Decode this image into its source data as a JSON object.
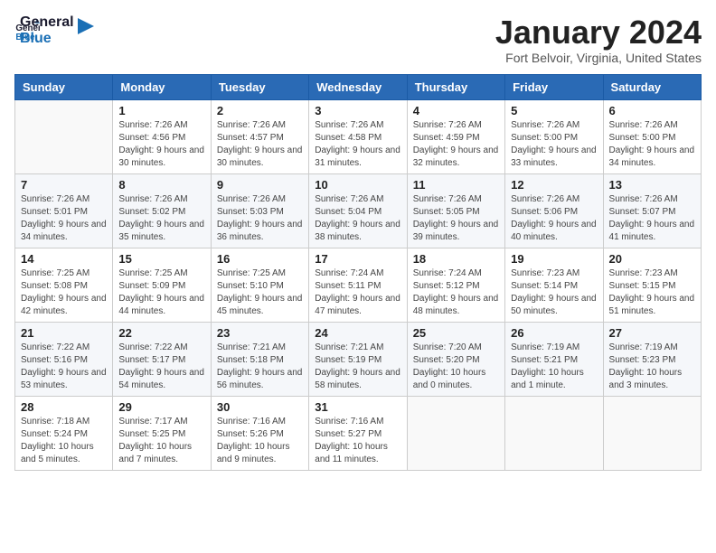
{
  "logo": {
    "line1": "General",
    "line2": "Blue"
  },
  "title": "January 2024",
  "location": "Fort Belvoir, Virginia, United States",
  "weekdays": [
    "Sunday",
    "Monday",
    "Tuesday",
    "Wednesday",
    "Thursday",
    "Friday",
    "Saturday"
  ],
  "weeks": [
    [
      {
        "day": "",
        "sunrise": "",
        "sunset": "",
        "daylight": ""
      },
      {
        "day": "1",
        "sunrise": "Sunrise: 7:26 AM",
        "sunset": "Sunset: 4:56 PM",
        "daylight": "Daylight: 9 hours and 30 minutes."
      },
      {
        "day": "2",
        "sunrise": "Sunrise: 7:26 AM",
        "sunset": "Sunset: 4:57 PM",
        "daylight": "Daylight: 9 hours and 30 minutes."
      },
      {
        "day": "3",
        "sunrise": "Sunrise: 7:26 AM",
        "sunset": "Sunset: 4:58 PM",
        "daylight": "Daylight: 9 hours and 31 minutes."
      },
      {
        "day": "4",
        "sunrise": "Sunrise: 7:26 AM",
        "sunset": "Sunset: 4:59 PM",
        "daylight": "Daylight: 9 hours and 32 minutes."
      },
      {
        "day": "5",
        "sunrise": "Sunrise: 7:26 AM",
        "sunset": "Sunset: 5:00 PM",
        "daylight": "Daylight: 9 hours and 33 minutes."
      },
      {
        "day": "6",
        "sunrise": "Sunrise: 7:26 AM",
        "sunset": "Sunset: 5:00 PM",
        "daylight": "Daylight: 9 hours and 34 minutes."
      }
    ],
    [
      {
        "day": "7",
        "sunrise": "Sunrise: 7:26 AM",
        "sunset": "Sunset: 5:01 PM",
        "daylight": "Daylight: 9 hours and 34 minutes."
      },
      {
        "day": "8",
        "sunrise": "Sunrise: 7:26 AM",
        "sunset": "Sunset: 5:02 PM",
        "daylight": "Daylight: 9 hours and 35 minutes."
      },
      {
        "day": "9",
        "sunrise": "Sunrise: 7:26 AM",
        "sunset": "Sunset: 5:03 PM",
        "daylight": "Daylight: 9 hours and 36 minutes."
      },
      {
        "day": "10",
        "sunrise": "Sunrise: 7:26 AM",
        "sunset": "Sunset: 5:04 PM",
        "daylight": "Daylight: 9 hours and 38 minutes."
      },
      {
        "day": "11",
        "sunrise": "Sunrise: 7:26 AM",
        "sunset": "Sunset: 5:05 PM",
        "daylight": "Daylight: 9 hours and 39 minutes."
      },
      {
        "day": "12",
        "sunrise": "Sunrise: 7:26 AM",
        "sunset": "Sunset: 5:06 PM",
        "daylight": "Daylight: 9 hours and 40 minutes."
      },
      {
        "day": "13",
        "sunrise": "Sunrise: 7:26 AM",
        "sunset": "Sunset: 5:07 PM",
        "daylight": "Daylight: 9 hours and 41 minutes."
      }
    ],
    [
      {
        "day": "14",
        "sunrise": "Sunrise: 7:25 AM",
        "sunset": "Sunset: 5:08 PM",
        "daylight": "Daylight: 9 hours and 42 minutes."
      },
      {
        "day": "15",
        "sunrise": "Sunrise: 7:25 AM",
        "sunset": "Sunset: 5:09 PM",
        "daylight": "Daylight: 9 hours and 44 minutes."
      },
      {
        "day": "16",
        "sunrise": "Sunrise: 7:25 AM",
        "sunset": "Sunset: 5:10 PM",
        "daylight": "Daylight: 9 hours and 45 minutes."
      },
      {
        "day": "17",
        "sunrise": "Sunrise: 7:24 AM",
        "sunset": "Sunset: 5:11 PM",
        "daylight": "Daylight: 9 hours and 47 minutes."
      },
      {
        "day": "18",
        "sunrise": "Sunrise: 7:24 AM",
        "sunset": "Sunset: 5:12 PM",
        "daylight": "Daylight: 9 hours and 48 minutes."
      },
      {
        "day": "19",
        "sunrise": "Sunrise: 7:23 AM",
        "sunset": "Sunset: 5:14 PM",
        "daylight": "Daylight: 9 hours and 50 minutes."
      },
      {
        "day": "20",
        "sunrise": "Sunrise: 7:23 AM",
        "sunset": "Sunset: 5:15 PM",
        "daylight": "Daylight: 9 hours and 51 minutes."
      }
    ],
    [
      {
        "day": "21",
        "sunrise": "Sunrise: 7:22 AM",
        "sunset": "Sunset: 5:16 PM",
        "daylight": "Daylight: 9 hours and 53 minutes."
      },
      {
        "day": "22",
        "sunrise": "Sunrise: 7:22 AM",
        "sunset": "Sunset: 5:17 PM",
        "daylight": "Daylight: 9 hours and 54 minutes."
      },
      {
        "day": "23",
        "sunrise": "Sunrise: 7:21 AM",
        "sunset": "Sunset: 5:18 PM",
        "daylight": "Daylight: 9 hours and 56 minutes."
      },
      {
        "day": "24",
        "sunrise": "Sunrise: 7:21 AM",
        "sunset": "Sunset: 5:19 PM",
        "daylight": "Daylight: 9 hours and 58 minutes."
      },
      {
        "day": "25",
        "sunrise": "Sunrise: 7:20 AM",
        "sunset": "Sunset: 5:20 PM",
        "daylight": "Daylight: 10 hours and 0 minutes."
      },
      {
        "day": "26",
        "sunrise": "Sunrise: 7:19 AM",
        "sunset": "Sunset: 5:21 PM",
        "daylight": "Daylight: 10 hours and 1 minute."
      },
      {
        "day": "27",
        "sunrise": "Sunrise: 7:19 AM",
        "sunset": "Sunset: 5:23 PM",
        "daylight": "Daylight: 10 hours and 3 minutes."
      }
    ],
    [
      {
        "day": "28",
        "sunrise": "Sunrise: 7:18 AM",
        "sunset": "Sunset: 5:24 PM",
        "daylight": "Daylight: 10 hours and 5 minutes."
      },
      {
        "day": "29",
        "sunrise": "Sunrise: 7:17 AM",
        "sunset": "Sunset: 5:25 PM",
        "daylight": "Daylight: 10 hours and 7 minutes."
      },
      {
        "day": "30",
        "sunrise": "Sunrise: 7:16 AM",
        "sunset": "Sunset: 5:26 PM",
        "daylight": "Daylight: 10 hours and 9 minutes."
      },
      {
        "day": "31",
        "sunrise": "Sunrise: 7:16 AM",
        "sunset": "Sunset: 5:27 PM",
        "daylight": "Daylight: 10 hours and 11 minutes."
      },
      {
        "day": "",
        "sunrise": "",
        "sunset": "",
        "daylight": ""
      },
      {
        "day": "",
        "sunrise": "",
        "sunset": "",
        "daylight": ""
      },
      {
        "day": "",
        "sunrise": "",
        "sunset": "",
        "daylight": ""
      }
    ]
  ]
}
